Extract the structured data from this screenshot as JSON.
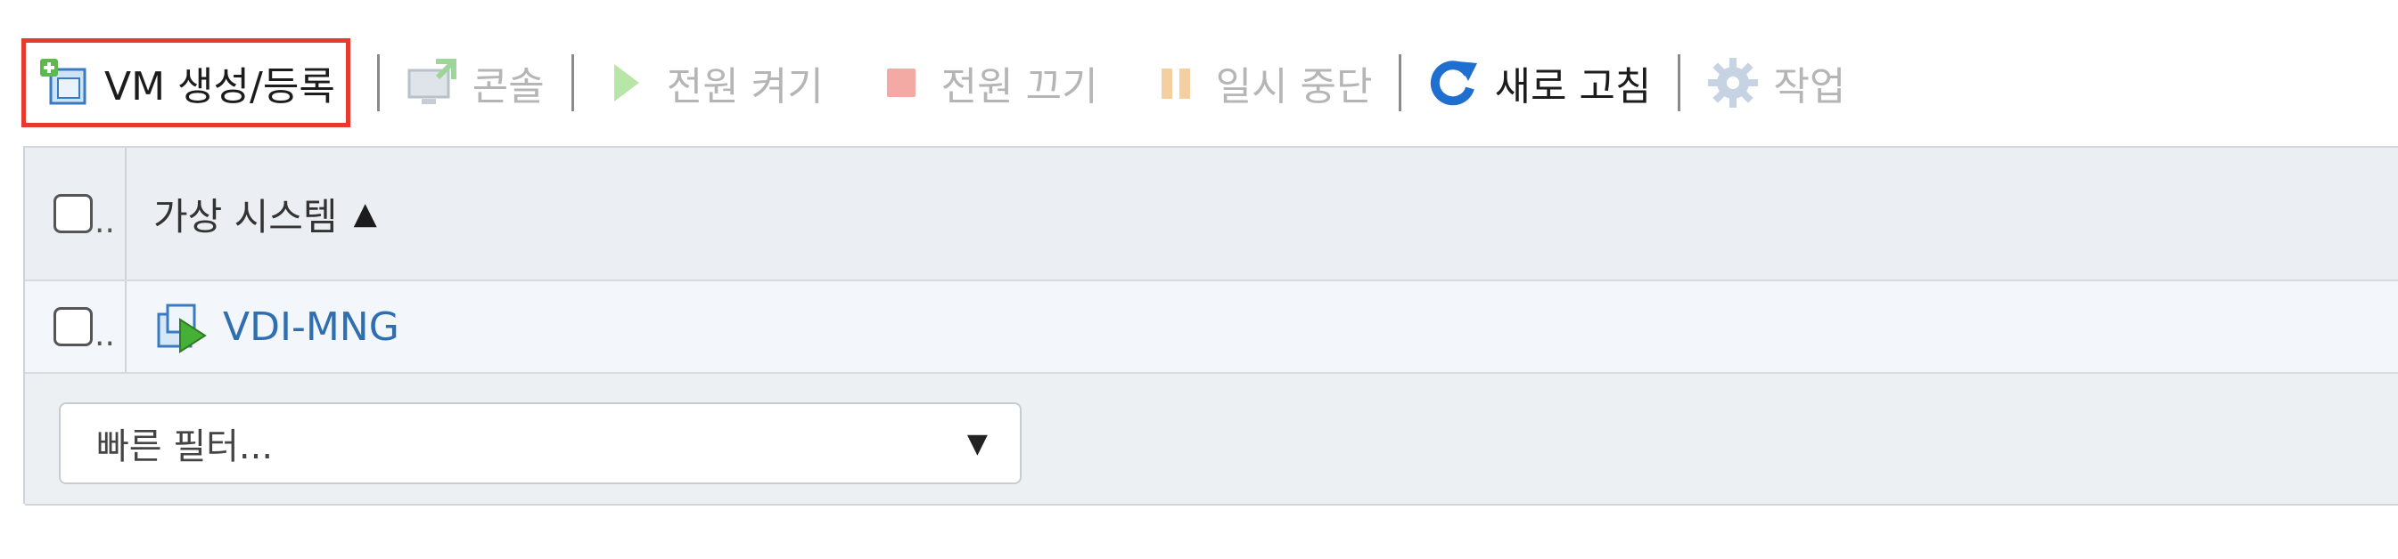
{
  "toolbar": {
    "create_label": "VM 생성/등록",
    "console_label": "콘솔",
    "power_on_label": "전원 켜기",
    "power_off_label": "전원 끄기",
    "suspend_label": "일시 중단",
    "refresh_label": "새로 고침",
    "actions_label": "작업"
  },
  "grid": {
    "header": {
      "name_column": "가상 시스템",
      "sort_indicator": "▲",
      "truncated": ".."
    },
    "rows": [
      {
        "name": "VDI-MNG",
        "truncated": ".."
      }
    ]
  },
  "filter": {
    "placeholder": "빠른 필터...",
    "caret": "▼"
  },
  "colors": {
    "highlight_border": "#e63a2e",
    "link": "#2f6fb0",
    "disabled_text": "#b5b5b5",
    "refresh_icon": "#1f6fd0"
  }
}
